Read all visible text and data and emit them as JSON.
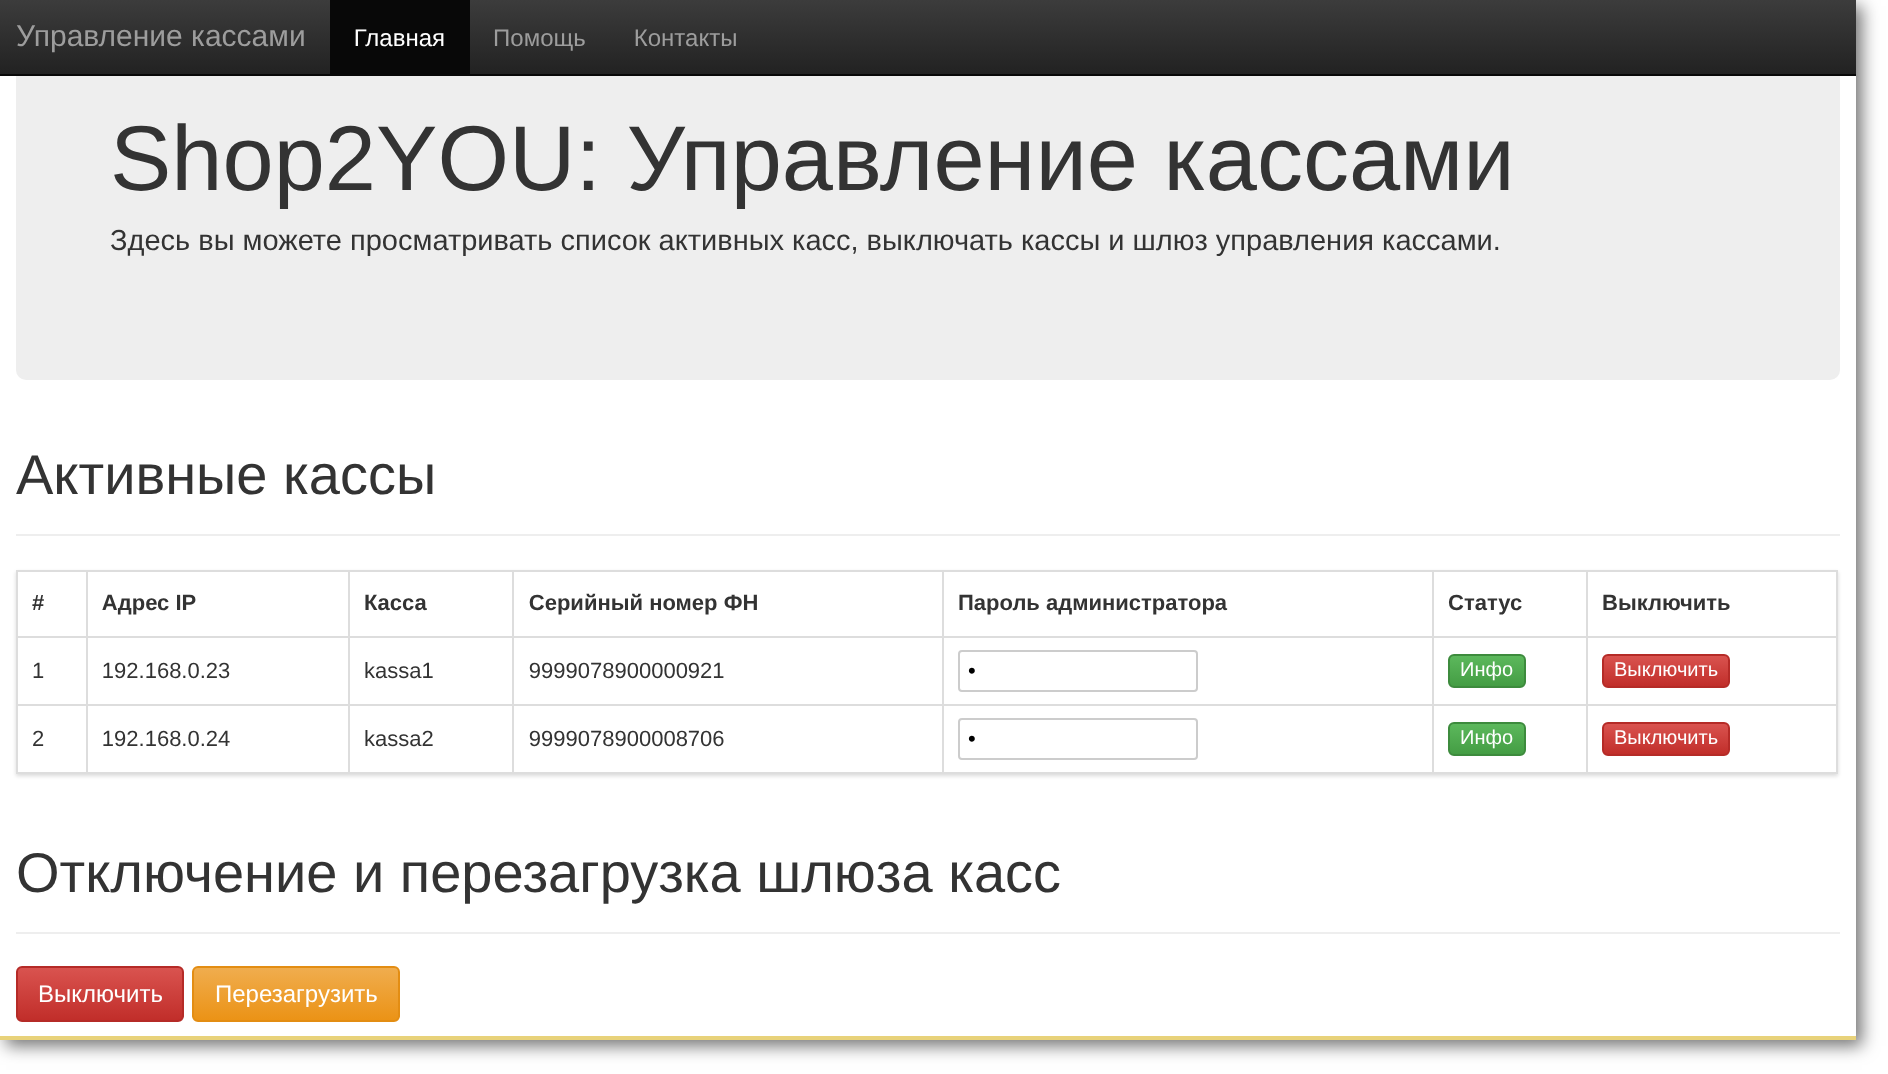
{
  "navbar": {
    "brand": "Управление кассами",
    "links": [
      {
        "label": "Главная",
        "selected": true
      },
      {
        "label": "Помощь",
        "selected": false
      },
      {
        "label": "Контакты",
        "selected": false
      }
    ]
  },
  "jumbotron": {
    "title": "Shop2YOU: Управление кассами",
    "text": "Здесь вы можете просматривать список активных касс, выключать кассы и шлюз управления кассами."
  },
  "registers_section": {
    "heading": "Активные кассы",
    "table": {
      "columns": [
        "#",
        "Адрес IP",
        "Касса",
        "Серийный номер ФН",
        "Пароль администратора",
        "Статус",
        "Выключить"
      ],
      "rows": [
        {
          "number": "1",
          "ip": "192.168.0.23",
          "register": "kassa1",
          "serial": "9999078900000921",
          "password": "•",
          "status_button": {
            "label": "Инфо",
            "kind": "success"
          },
          "off_button": {
            "label": "Выключить",
            "kind": "danger"
          }
        },
        {
          "number": "2",
          "ip": "192.168.0.24",
          "register": "kassa2",
          "serial": "9999078900008706",
          "password": "•",
          "status_button": {
            "label": "Инфо",
            "kind": "success"
          },
          "off_button": {
            "label": "Выключить",
            "kind": "danger"
          }
        }
      ]
    }
  },
  "gateway_section": {
    "heading": "Отключение и перезагрузка шлюза касс",
    "buttons": [
      {
        "label": "Выключить",
        "kind": "danger"
      },
      {
        "label": "Перезагрузить",
        "kind": "warning"
      }
    ]
  }
}
